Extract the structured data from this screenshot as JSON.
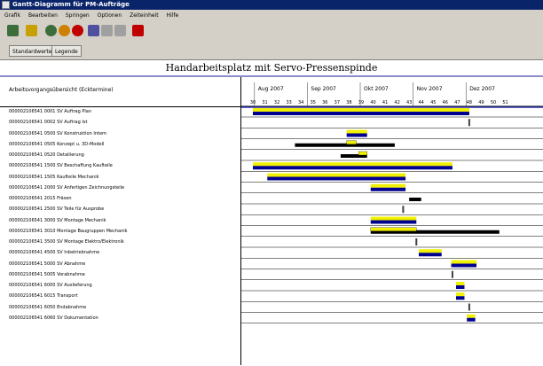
{
  "window": {
    "title": "Gantt-Diagramm für PM-Aufträge"
  },
  "menu": [
    "Grafik",
    "Bearbeiten",
    "Springen",
    "Optionen",
    "Zeiteinheit",
    "Hilfe"
  ],
  "toolbar": [
    {
      "icon": "check-icon",
      "color": "#3c6e3c"
    },
    {
      "icon": "save-icon",
      "color": "#c8a000"
    },
    {
      "icon": "back-icon",
      "color": "#3c6e3c"
    },
    {
      "icon": "exit-icon",
      "color": "#d08000"
    },
    {
      "icon": "cancel-icon",
      "color": "#c00000"
    },
    {
      "icon": "print-icon",
      "color": "#5050a0"
    },
    {
      "icon": "layout-icon",
      "color": "#a0a0a0"
    },
    {
      "icon": "grid-icon",
      "color": "#a0a0a0"
    },
    {
      "icon": "help-icon",
      "color": "#c00000"
    }
  ],
  "tabs": [
    "Standardwerte",
    "Legende"
  ],
  "chart": {
    "title": "Handarbeitsplatz mit Servo-Pressenspinde",
    "header_label": "Arbeitsvorgangsübersicht (Ecktermine)",
    "months": [
      "Aug 2007",
      "Sep 2007",
      "Okt 2007",
      "Nov 2007",
      "Dez 2007"
    ],
    "weeks": [
      "30",
      "31",
      "32",
      "33",
      "34",
      "35",
      "36",
      "37",
      "38",
      "39",
      "40",
      "41",
      "42",
      "43",
      "44",
      "45",
      "46",
      "47",
      "48",
      "49",
      "50",
      "51"
    ],
    "colors": {
      "plan": "#f0f000",
      "actual": "#000090",
      "black": "#000000"
    },
    "tasks": [
      {
        "label": "000002106541 0001 SV Auftrag Plan",
        "bars": [
          {
            "type": "plan-actual",
            "start": 30.0,
            "end": 48.0
          }
        ]
      },
      {
        "label": "000002106541 0002 SV Auftrag Ist",
        "bars": [
          {
            "type": "marker",
            "start": 48.0,
            "end": 48.0
          }
        ]
      },
      {
        "label": "000002106541 0500 SV Konstruktion Intern",
        "bars": [
          {
            "type": "plan-actual",
            "start": 37.8,
            "end": 39.5
          }
        ]
      },
      {
        "label": "000002106541 0505 Konzept u. 3D-Modell",
        "bars": [
          {
            "type": "black",
            "start": 33.5,
            "end": 41.8
          },
          {
            "type": "plan",
            "start": 37.8,
            "end": 38.6
          }
        ]
      },
      {
        "label": "000002106541 0520 Detailierung",
        "bars": [
          {
            "type": "black",
            "start": 37.3,
            "end": 39.5
          },
          {
            "type": "plan",
            "start": 38.8,
            "end": 39.5
          }
        ]
      },
      {
        "label": "000002106541 1500 SV Beschaffung Kaufteile",
        "bars": [
          {
            "type": "plan-actual",
            "start": 30.0,
            "end": 46.6
          }
        ]
      },
      {
        "label": "000002106541 1505 Kaufteile Mechanik",
        "bars": [
          {
            "type": "plan-actual",
            "start": 31.2,
            "end": 42.7
          }
        ]
      },
      {
        "label": "000002106541 2000 SV Anfertigen Zeichnungsteile",
        "bars": [
          {
            "type": "plan-actual",
            "start": 39.8,
            "end": 42.7
          }
        ]
      },
      {
        "label": "000002106541 2015 Fräsen",
        "bars": [
          {
            "type": "black",
            "start": 43.0,
            "end": 44.0
          }
        ]
      },
      {
        "label": "000002106541 2500 SV Teile für Ausprobe",
        "bars": [
          {
            "type": "marker",
            "start": 42.5,
            "end": 42.5
          }
        ]
      },
      {
        "label": "000002106541 3000 SV Montage Mechanik",
        "bars": [
          {
            "type": "plan-actual",
            "start": 39.8,
            "end": 43.6
          }
        ]
      },
      {
        "label": "000002106541 3010 Montage Baugruppen Mechanik",
        "bars": [
          {
            "type": "black",
            "start": 39.8,
            "end": 50.5
          },
          {
            "type": "plan",
            "start": 39.8,
            "end": 43.6
          }
        ]
      },
      {
        "label": "000002106541 3500 SV Montage Elektro/Elektronik",
        "bars": [
          {
            "type": "marker",
            "start": 43.6,
            "end": 43.6
          }
        ]
      },
      {
        "label": "000002106541 4500 SV Inbetriebnahme",
        "bars": [
          {
            "type": "plan-actual",
            "start": 43.8,
            "end": 45.7
          }
        ]
      },
      {
        "label": "000002106541 5000 SV Abnahme",
        "bars": [
          {
            "type": "plan-actual",
            "start": 46.5,
            "end": 48.6
          }
        ]
      },
      {
        "label": "000002106541 5005 Vorabnahme",
        "bars": [
          {
            "type": "marker",
            "start": 46.6,
            "end": 46.6
          }
        ]
      },
      {
        "label": "000002106541 6000 SV Auslieferung",
        "bars": [
          {
            "type": "plan-actual",
            "start": 46.9,
            "end": 47.6
          }
        ]
      },
      {
        "label": "000002106541 6015 Transport",
        "bars": [
          {
            "type": "plan-actual",
            "start": 46.9,
            "end": 47.6
          }
        ]
      },
      {
        "label": "000002106541 6050 Endabnahme",
        "bars": [
          {
            "type": "marker",
            "start": 48.0,
            "end": 48.0
          }
        ]
      },
      {
        "label": "000002106541 6060 SV Dokumentation",
        "bars": [
          {
            "type": "plan-actual",
            "start": 47.8,
            "end": 48.5
          }
        ]
      }
    ]
  }
}
